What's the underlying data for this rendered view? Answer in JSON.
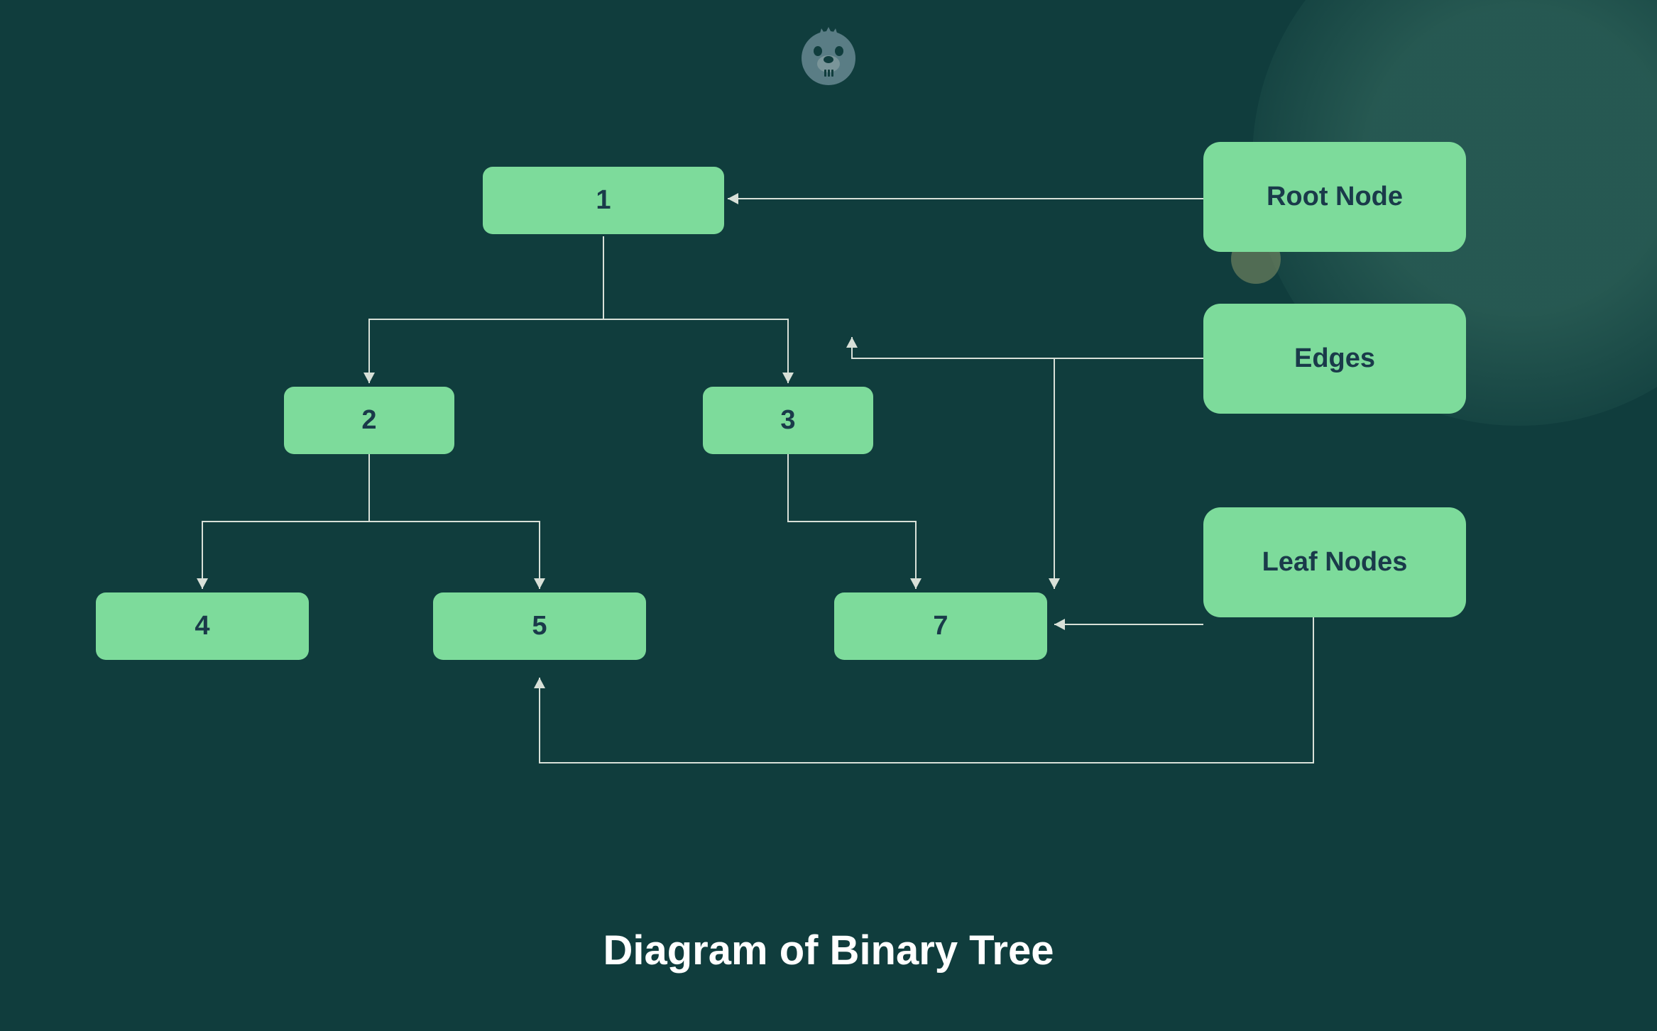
{
  "title": "Diagram of Binary Tree",
  "nodes": {
    "root": "1",
    "left": "2",
    "right": "3",
    "leaf1": "4",
    "leaf2": "5",
    "leaf3": "7"
  },
  "labels": {
    "root": "Root Node",
    "edges": "Edges",
    "leaves": "Leaf Nodes"
  },
  "diagram": {
    "type": "binary_tree",
    "structure": {
      "value": 1,
      "role": "root",
      "left": {
        "value": 2,
        "role": "internal",
        "left": {
          "value": 4,
          "role": "leaf"
        },
        "right": {
          "value": 5,
          "role": "leaf"
        }
      },
      "right": {
        "value": 3,
        "role": "internal",
        "right": {
          "value": 7,
          "role": "leaf"
        }
      }
    },
    "annotations": [
      {
        "label": "Root Node",
        "targets": [
          1
        ]
      },
      {
        "label": "Edges",
        "targets": [
          "tree-edges"
        ]
      },
      {
        "label": "Leaf Nodes",
        "targets": [
          5,
          7
        ]
      }
    ]
  }
}
